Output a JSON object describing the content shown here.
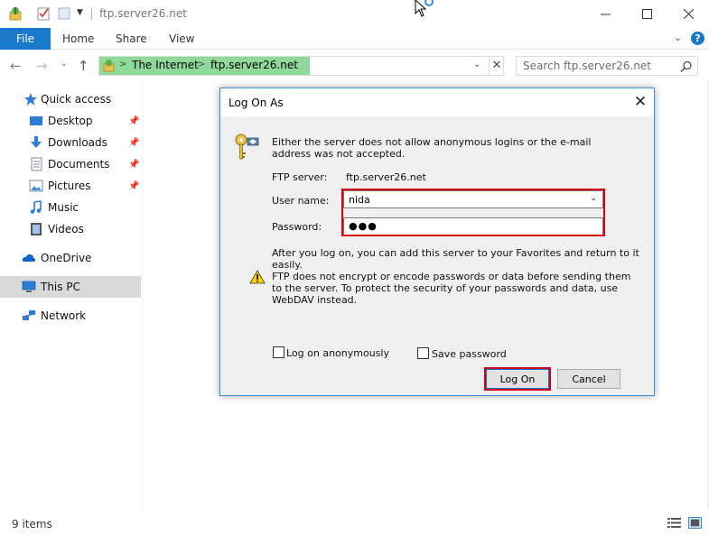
{
  "window": {
    "title": "ftp.server26.net",
    "minimize_icon": "minimize-icon",
    "maximize_icon": "maximize-icon",
    "close_icon": "close-icon"
  },
  "ribbon": {
    "tabs": [
      {
        "label": "File"
      },
      {
        "label": "Home"
      },
      {
        "label": "Share"
      },
      {
        "label": "View"
      }
    ],
    "accent": "#1979ca"
  },
  "nav": {
    "address": {
      "crumbs": [
        "The Internet",
        "ftp.server26.net"
      ],
      "highlight_color": "#8fd99a"
    },
    "search": {
      "placeholder": "Search ftp.server26.net"
    }
  },
  "sidebar": {
    "items": [
      {
        "label": "Quick access",
        "icon": "star-icon"
      },
      {
        "label": "Desktop",
        "icon": "desktop-icon",
        "pinned": true
      },
      {
        "label": "Downloads",
        "icon": "download-arrow-icon",
        "pinned": true
      },
      {
        "label": "Documents",
        "icon": "documents-icon",
        "pinned": true
      },
      {
        "label": "Pictures",
        "icon": "pictures-icon",
        "pinned": true
      },
      {
        "label": "Music",
        "icon": "music-note-icon"
      },
      {
        "label": "Videos",
        "icon": "videos-icon"
      },
      {
        "label": "OneDrive",
        "icon": "cloud-icon"
      },
      {
        "label": "This PC",
        "icon": "computer-icon",
        "selected": true
      },
      {
        "label": "Network",
        "icon": "network-icon"
      }
    ]
  },
  "status": {
    "items_count": "9 items"
  },
  "dialog": {
    "title": "Log On As",
    "intro": "Either the server does not allow anonymous logins or the e-mail address was not accepted.",
    "ftp_server_label": "FTP server:",
    "ftp_server_value": "ftp.server26.net",
    "username_label": "User name:",
    "username_value": "nida",
    "password_label": "Password:",
    "password_value": "●●●",
    "favorites_note": "After you log on, you can add this server to your Favorites and return to it easily.",
    "warning": "FTP does not encrypt or encode passwords or data before sending them to the server.  To protect the security of your passwords and data, use WebDAV instead.",
    "anon_label": "Log on anonymously",
    "save_pw_label": "Save password",
    "logon_button": "Log On",
    "cancel_button": "Cancel",
    "highlight_color": "#d70012"
  }
}
